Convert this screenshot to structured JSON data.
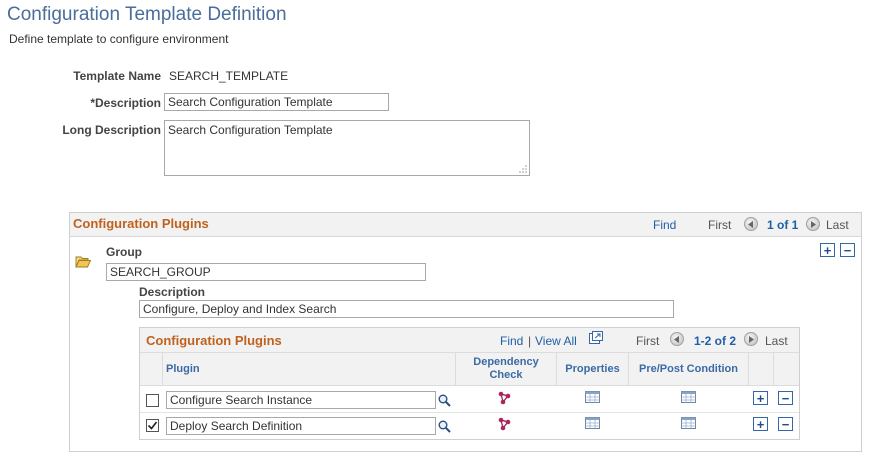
{
  "page": {
    "title": "Configuration Template Definition",
    "subtitle": "Define template to configure environment"
  },
  "form": {
    "template_name_label": "Template Name",
    "template_name_value": "SEARCH_TEMPLATE",
    "description_label": "*Description",
    "description_value": "Search Configuration Template",
    "long_description_label": "Long Description",
    "long_description_value": "Search Configuration Template"
  },
  "outer_grid": {
    "title": "Configuration Plugins",
    "find": "Find",
    "first": "First",
    "range": "1 of 1",
    "last": "Last",
    "group_label": "Group",
    "group_value": "SEARCH_GROUP",
    "description_label": "Description",
    "description_value": "Configure, Deploy and Index Search"
  },
  "inner_grid": {
    "title": "Configuration Plugins",
    "find": "Find",
    "separator": "|",
    "view_all": "View All",
    "first": "First",
    "range": "1-2 of 2",
    "last": "Last",
    "columns": {
      "plugin": "Plugin",
      "dependency_line1": "Dependency",
      "dependency_line2": "Check",
      "properties": "Properties",
      "prepost": "Pre/Post Condition"
    },
    "rows": [
      {
        "checked": false,
        "plugin": "Configure Search Instance"
      },
      {
        "checked": true,
        "plugin": "Deploy Search Definition"
      }
    ]
  },
  "icons": {
    "add": "+",
    "delete": "−",
    "folder": "folder-open-icon",
    "lookup": "magnifier-icon",
    "dependency": "molecule-icon",
    "properties": "grid-icon"
  },
  "colors": {
    "title_blue": "#4a6d9a",
    "section_orange": "#c0621d",
    "link_blue": "#1f5fa8"
  }
}
